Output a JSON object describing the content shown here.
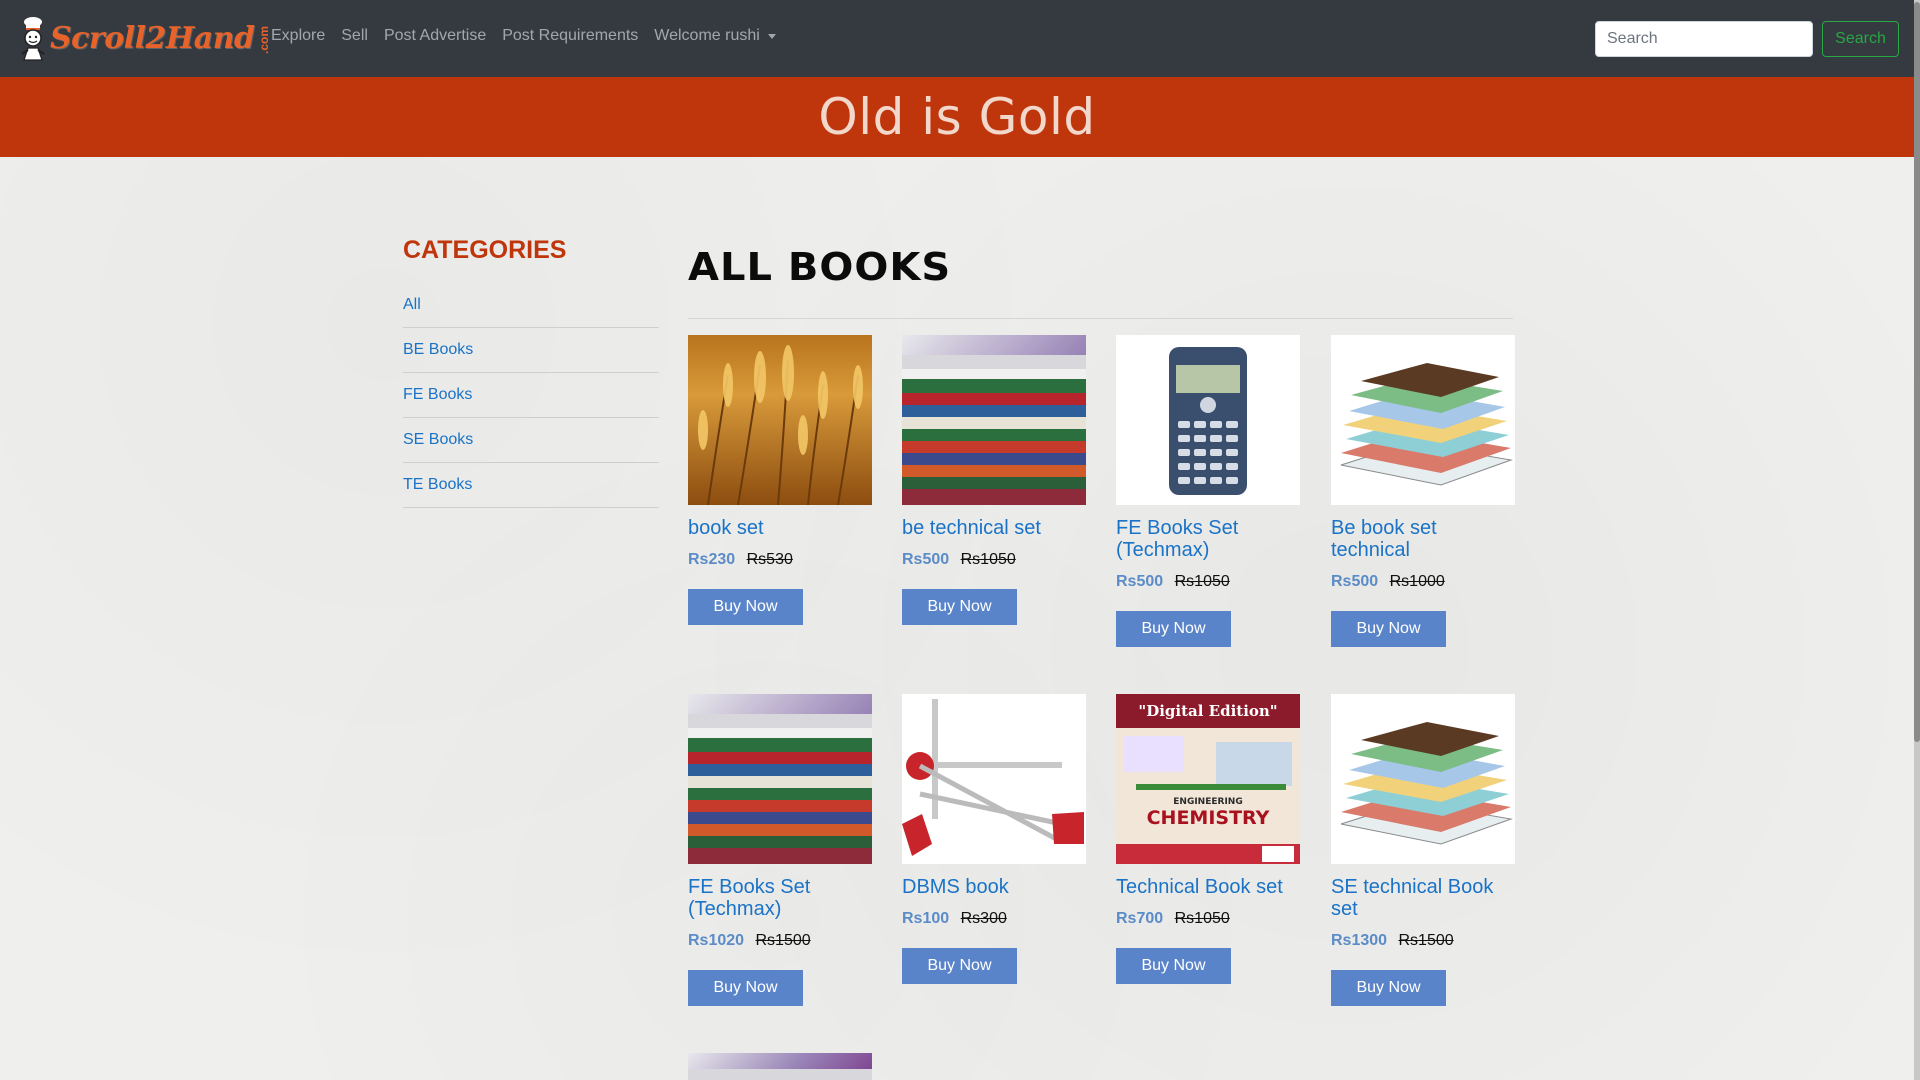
{
  "navbar": {
    "brand_text": "Scroll2Hand",
    "brand_suffix": ".com",
    "links": [
      "Explore",
      "Sell",
      "Post Advertise",
      "Post Requirements"
    ],
    "user_menu": "Welcome rushi",
    "search_placeholder": "Search",
    "search_button": "Search"
  },
  "hero": {
    "title": "Old is Gold"
  },
  "sidebar": {
    "title": "CATEGORIES",
    "items": [
      "All",
      "BE Books",
      "FE Books",
      "SE Books",
      "TE Books"
    ]
  },
  "main": {
    "title": "All Books",
    "buy_label": "Buy Now",
    "products": [
      {
        "name": "book set",
        "price": "Rs230",
        "old_price": "Rs530",
        "image": "wheat-field"
      },
      {
        "name": "be technical set",
        "price": "Rs500",
        "old_price": "Rs1050",
        "image": "book-stack-photo"
      },
      {
        "name": "FE Books Set (Techmax)",
        "price": "Rs500",
        "old_price": "Rs1050",
        "image": "calculator"
      },
      {
        "name": "Be book set technical",
        "price": "Rs500",
        "old_price": "Rs1000",
        "image": "book-pile-illustration"
      },
      {
        "name": "FE Books Set (Techmax)",
        "price": "Rs1020",
        "old_price": "Rs1500",
        "image": "book-stack-photo"
      },
      {
        "name": "DBMS book",
        "price": "Rs100",
        "old_price": "Rs300",
        "image": "drafter-tool"
      },
      {
        "name": "Technical Book set",
        "price": "Rs700",
        "old_price": "Rs1050",
        "image": "chemistry-book-cover"
      },
      {
        "name": "SE technical Book set",
        "price": "Rs1300",
        "old_price": "Rs1500",
        "image": "book-pile-illustration"
      }
    ],
    "chem_cover": {
      "banner": "\"Digital Edition\"",
      "subject": "ENGINEERING",
      "title": "CHEMISTRY"
    }
  },
  "colors": {
    "navbar": "#343a40",
    "hero": "#c0360c",
    "link": "#1a73c7",
    "button": "#5a84c9",
    "search_button": "#28a745"
  }
}
